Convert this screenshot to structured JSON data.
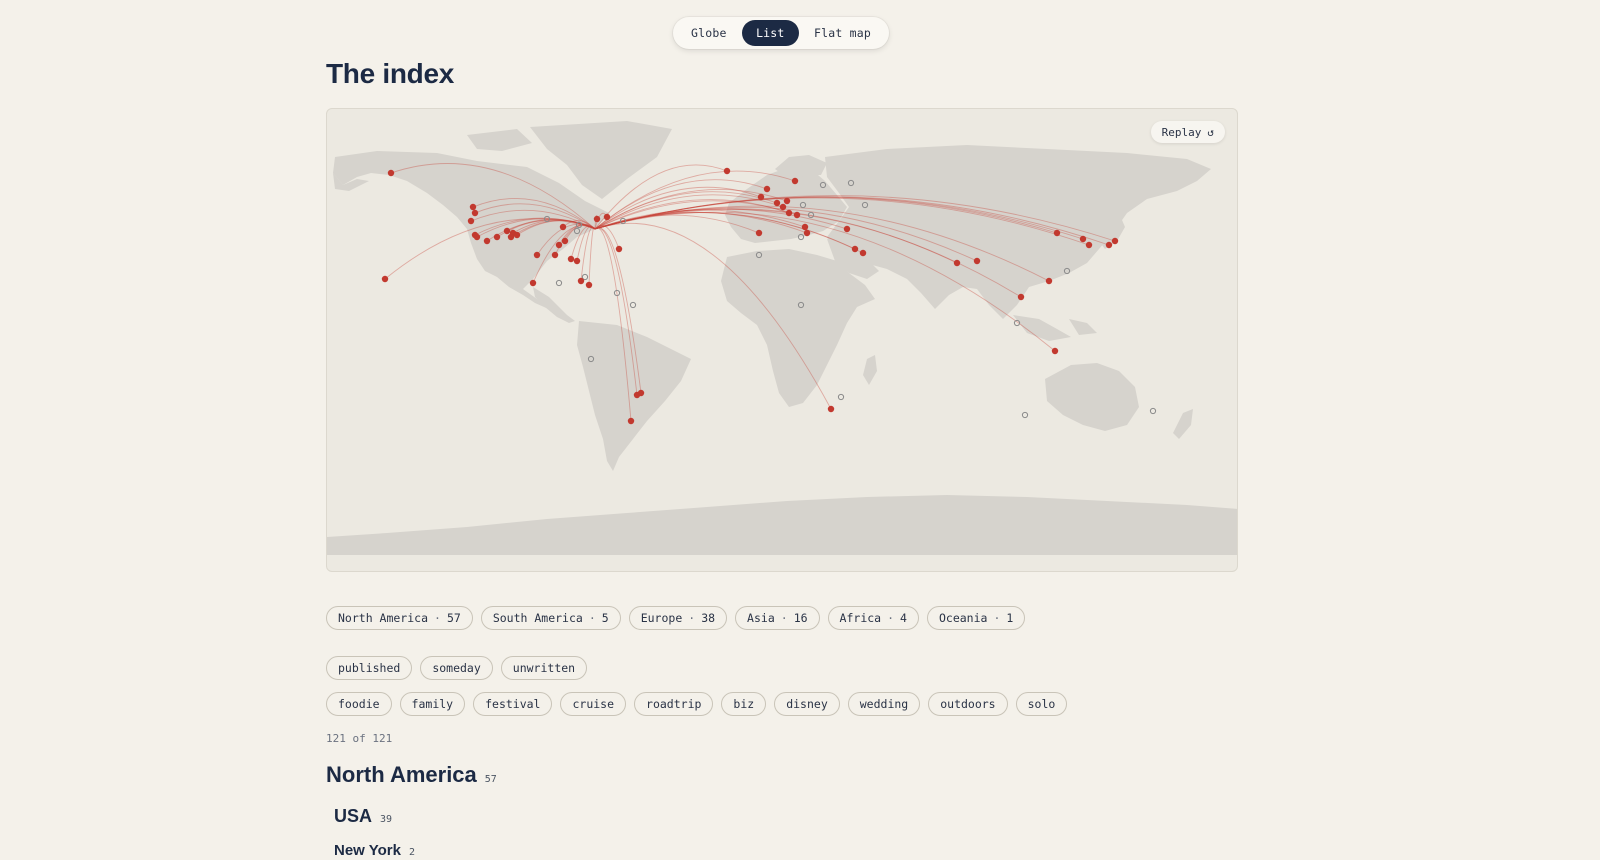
{
  "view_toggle": {
    "options": [
      "Globe",
      "List",
      "Flat map"
    ],
    "active": "List"
  },
  "page_title": "The index",
  "map": {
    "replay_label": "Replay",
    "replay_icon": "↺",
    "land_color": "#d6d3cd",
    "ocean_color": "#ece9e1",
    "route_color": "#c9453a",
    "visited_color": "#c2392f"
  },
  "regions": [
    {
      "name": "North America",
      "count": 57
    },
    {
      "name": "South America",
      "count": 5
    },
    {
      "name": "Europe",
      "count": 38
    },
    {
      "name": "Asia",
      "count": 16
    },
    {
      "name": "Africa",
      "count": 4
    },
    {
      "name": "Oceania",
      "count": 1
    }
  ],
  "status_filters": [
    "published",
    "someday",
    "unwritten"
  ],
  "tag_filters": [
    "foodie",
    "family",
    "festival",
    "cruise",
    "roadtrip",
    "biz",
    "disney",
    "wedding",
    "outdoors",
    "solo"
  ],
  "result_count": "121 of 121",
  "sections": {
    "region": {
      "title": "North America",
      "count": "57"
    },
    "country": {
      "title": "USA",
      "count": "39"
    },
    "city": {
      "title": "New York",
      "count": "2"
    }
  }
}
